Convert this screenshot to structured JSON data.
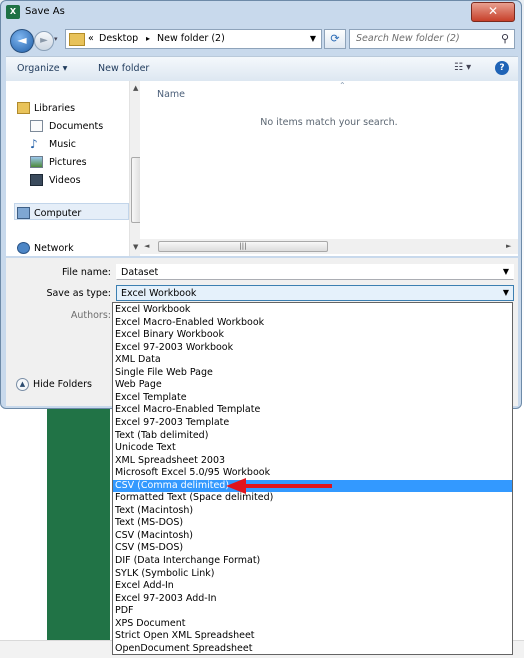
{
  "window": {
    "title": "Save As",
    "app_icon": "excel-icon",
    "close_glyph": "✕"
  },
  "nav": {
    "back_glyph": "◄",
    "forward_glyph": "►",
    "breadcrumb": [
      "Desktop",
      "New folder (2)"
    ],
    "overflow": "«",
    "separator": "▸",
    "search_placeholder": "Search New folder (2)"
  },
  "toolbar": {
    "organize": "Organize ▾",
    "new_folder": "New folder",
    "views_glyph": "☷ ▾",
    "help_glyph": "?"
  },
  "sidebar": {
    "items": [
      {
        "label": "Libraries",
        "icon": "libraries-icon"
      },
      {
        "label": "Documents",
        "icon": "documents-icon"
      },
      {
        "label": "Music",
        "icon": "music-icon"
      },
      {
        "label": "Pictures",
        "icon": "pictures-icon"
      },
      {
        "label": "Videos",
        "icon": "videos-icon"
      },
      {
        "label": "Computer",
        "icon": "computer-icon"
      },
      {
        "label": "Network",
        "icon": "network-icon"
      }
    ]
  },
  "content": {
    "column_name": "Name",
    "empty_message": "No items match your search."
  },
  "form": {
    "file_name_label": "File name:",
    "file_name_value": "Dataset",
    "save_type_label": "Save as type:",
    "save_type_value": "Excel Workbook",
    "authors_label": "Authors:",
    "hide_folders": "Hide Folders"
  },
  "dropdown": {
    "selected_index": 15,
    "options": [
      "Excel Workbook",
      "Excel Macro-Enabled Workbook",
      "Excel Binary Workbook",
      "Excel 97-2003 Workbook",
      "XML Data",
      "Single File Web Page",
      "Web Page",
      "Excel Template",
      "Excel Macro-Enabled Template",
      "Excel 97-2003 Template",
      "Text (Tab delimited)",
      "Unicode Text",
      "XML Spreadsheet 2003",
      "Microsoft Excel 5.0/95 Workbook",
      "CSV (Comma delimited)",
      "Formatted Text (Space delimited)",
      "Text (Macintosh)",
      "Text (MS-DOS)",
      "CSV (Macintosh)",
      "CSV (MS-DOS)",
      "DIF (Data Interchange Format)",
      "SYLK (Symbolic Link)",
      "Excel Add-In",
      "Excel 97-2003 Add-In",
      "PDF",
      "XPS Document",
      "Strict Open XML Spreadsheet",
      "OpenDocument Spreadsheet"
    ],
    "highlighted": "CSV (Comma delimited)"
  },
  "colors": {
    "highlight": "#3399ff",
    "arrow": "#e0141e",
    "excel_green": "#217346"
  }
}
